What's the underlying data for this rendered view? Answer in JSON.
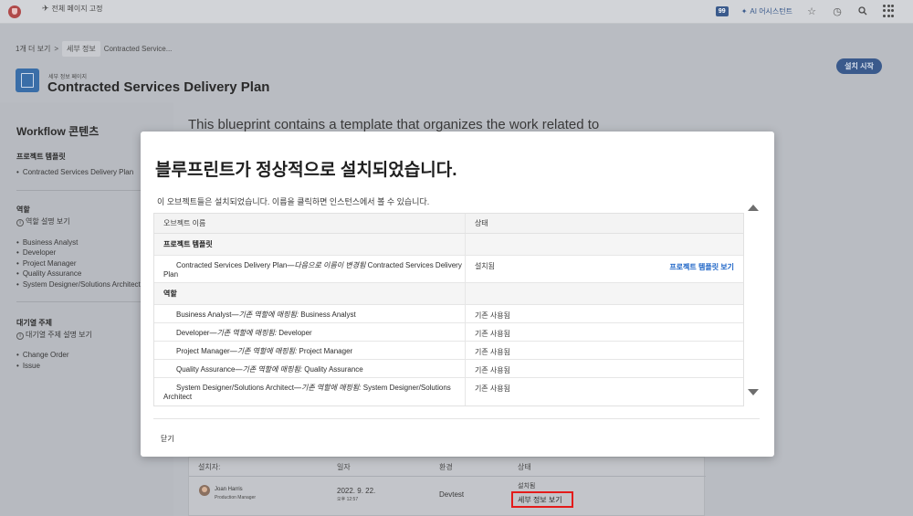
{
  "topbar": {
    "pin_label": "전체 페이지 고정",
    "notifications_count": "99",
    "ai_label": "AI 어시스턴트"
  },
  "breadcrumb": {
    "more": "1개 더 보기",
    "separator": ">",
    "current": "세부 정보",
    "trail": "Contracted Service..."
  },
  "page": {
    "kicker": "세부 정보 페이지",
    "title": "Contracted Services Delivery Plan",
    "install_button": "설치 시작",
    "description": "This blueprint contains a template that organizes the work related to"
  },
  "sidebar": {
    "title": "Workflow 콘텐츠",
    "project_templates_heading": "프로젝트 템플릿",
    "project_templates": [
      "Contracted Services Delivery Plan"
    ],
    "roles_heading": "역할",
    "roles_link": "역할 설명 보기",
    "roles": [
      "Business Analyst",
      "Developer",
      "Project Manager",
      "Quality Assurance",
      "System Designer/Solutions Architect"
    ],
    "topics_heading": "대기열 주제",
    "topics_link": "대기열 주제 설명 보기",
    "topics": [
      "Change Order",
      "Issue"
    ]
  },
  "bg_table": {
    "headers": [
      "설치자:",
      "일자",
      "환경",
      "상태"
    ],
    "row": {
      "name": "Joan Harris",
      "role": "Production Manager",
      "date": "2022. 9. 22.",
      "time": "오후 12:57",
      "env": "Devtest",
      "status": "설치됨",
      "detail_link": "세부 정보 보기"
    }
  },
  "modal": {
    "title": "블루프린트가 정상적으로 설치되었습니다.",
    "subtitle": "이 오브젝트들은 설치되었습니다. 이름을 클릭하면 인스턴스에서 볼 수 있습니다.",
    "col_object": "오브젝트 이름",
    "col_status": "상태",
    "sections": [
      {
        "heading": "프로젝트 템플릿",
        "rows": [
          {
            "name": "Contracted Services Delivery Plan",
            "note": "—다음으로 이름이 변경됨 ",
            "target": "Contracted Services Delivery Plan",
            "status": "설치됨",
            "link": "프로젝트 템플릿 보기"
          }
        ]
      },
      {
        "heading": "역할",
        "rows": [
          {
            "name": "Business Analyst",
            "note": "—기존 역할에 매핑됨: ",
            "target": "Business Analyst",
            "status": "기존 사용됨"
          },
          {
            "name": "Developer",
            "note": "—기존 역할에 매핑됨: ",
            "target": "Developer",
            "status": "기존 사용됨"
          },
          {
            "name": "Project Manager",
            "note": "—기존 역할에 매핑됨: ",
            "target": "Project Manager",
            "status": "기존 사용됨"
          },
          {
            "name": "Quality Assurance",
            "note": "—기존 역할에 매핑됨: ",
            "target": "Quality Assurance",
            "status": "기존 사용됨"
          },
          {
            "name": "System Designer/Solutions Architect",
            "note": "—기존 역할에 매핑됨: ",
            "target": "System Designer/Solutions Architect",
            "status": "기존 사용됨"
          }
        ]
      }
    ],
    "close_button": "닫기"
  },
  "colors": {
    "accent": "#1b63c6",
    "highlight_border": "#e31b1b",
    "primary_button": "#3a5a8c"
  }
}
